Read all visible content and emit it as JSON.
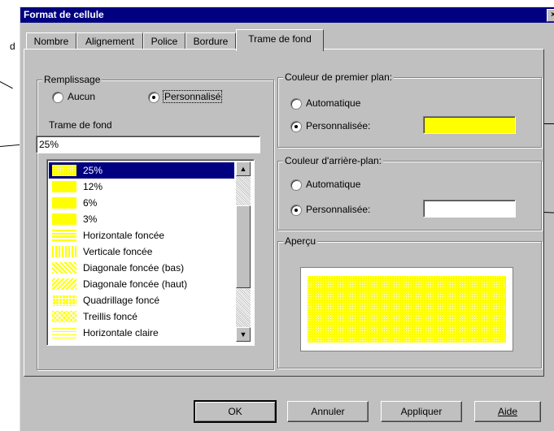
{
  "window": {
    "title": "Format de cellule",
    "close_label": "×"
  },
  "stray_text": "d",
  "tabs": [
    {
      "label": "Nombre",
      "active": false
    },
    {
      "label": "Alignement",
      "active": false
    },
    {
      "label": "Police",
      "active": false
    },
    {
      "label": "Bordure",
      "active": false
    },
    {
      "label": "Trame de fond",
      "active": true
    }
  ],
  "fill": {
    "legend": "Remplissage",
    "option_none": "Aucun",
    "option_custom": "Personnalisé",
    "selected": "Personnalisé",
    "pattern_label": "Trame de fond",
    "pattern_value": "25%",
    "patterns": [
      {
        "label": "25%",
        "icon": "pattern-25-icon",
        "selected": true
      },
      {
        "label": "12%",
        "icon": "pattern-12-icon",
        "selected": false
      },
      {
        "label": "6%",
        "icon": "pattern-6-icon",
        "selected": false
      },
      {
        "label": "3%",
        "icon": "pattern-3-icon",
        "selected": false
      },
      {
        "label": "Horizontale foncée",
        "icon": "pattern-horizontal-dark-icon",
        "selected": false
      },
      {
        "label": "Verticale foncée",
        "icon": "pattern-vertical-dark-icon",
        "selected": false
      },
      {
        "label": "Diagonale foncée (bas)",
        "icon": "pattern-diagonal-down-icon",
        "selected": false
      },
      {
        "label": "Diagonale foncée (haut)",
        "icon": "pattern-diagonal-up-icon",
        "selected": false
      },
      {
        "label": "Quadrillage foncé",
        "icon": "pattern-grid-dark-icon",
        "selected": false
      },
      {
        "label": "Treillis foncé",
        "icon": "pattern-trellis-dark-icon",
        "selected": false
      },
      {
        "label": "Horizontale claire",
        "icon": "pattern-horizontal-light-icon",
        "selected": false
      }
    ]
  },
  "foreground": {
    "legend": "Couleur de premier plan:",
    "option_auto": "Automatique",
    "option_custom": "Personnalisée:",
    "selected": "Personnalisée:",
    "color": "#ffff00"
  },
  "background": {
    "legend": "Couleur d'arrière-plan:",
    "option_auto": "Automatique",
    "option_custom": "Personnalisée:",
    "selected": "Personnalisée:",
    "color": "#ffffff"
  },
  "preview": {
    "legend": "Aperçu"
  },
  "buttons": {
    "ok": "OK",
    "cancel": "Annuler",
    "apply": "Appliquer",
    "help": "Aide"
  },
  "scrollbar": {
    "up": "▲",
    "down": "▼"
  }
}
